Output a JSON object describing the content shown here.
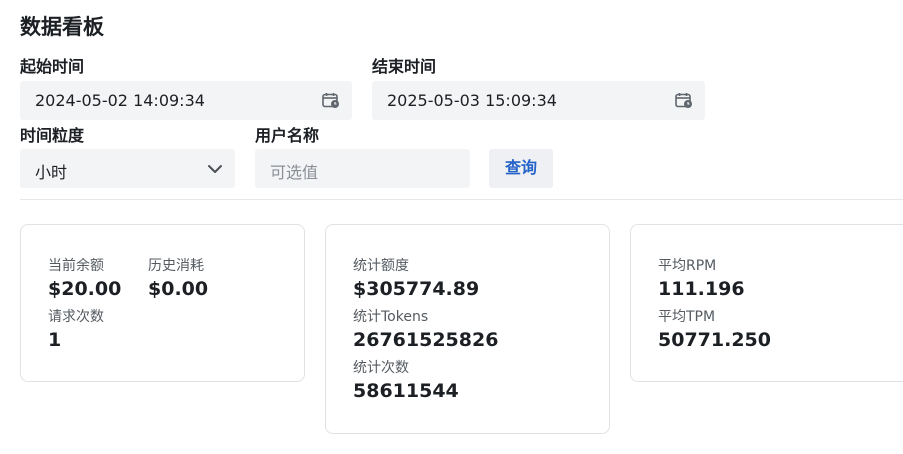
{
  "header": {
    "title": "数据看板"
  },
  "filters": {
    "start_time": {
      "label": "起始时间",
      "value": "2024-05-02 14:09:34",
      "icon": "calendar-clock-icon"
    },
    "end_time": {
      "label": "结束时间",
      "value": "2025-05-03 15:09:34",
      "icon": "calendar-clock-icon"
    },
    "granularity": {
      "label": "时间粒度",
      "value": "小时",
      "icon": "chevron-down-icon"
    },
    "username": {
      "label": "用户名称",
      "placeholder": "可选值",
      "value": ""
    },
    "query_label": "查询"
  },
  "cards": {
    "account": {
      "balance": {
        "label": "当前余额",
        "value": "$20.00"
      },
      "history_usage": {
        "label": "历史消耗",
        "value": "$0.00"
      },
      "request_count": {
        "label": "请求次数",
        "value": "1"
      }
    },
    "usage": {
      "quota": {
        "label": "统计额度",
        "value": "$305774.89"
      },
      "tokens": {
        "label": "统计Tokens",
        "value": "26761525826"
      },
      "count": {
        "label": "统计次数",
        "value": "58611544"
      }
    },
    "performance": {
      "rpm": {
        "label": "平均RPM",
        "value": "111.196"
      },
      "tpm": {
        "label": "平均TPM",
        "value": "50771.250"
      }
    }
  },
  "colors": {
    "accent": "#2463c9",
    "field_bg": "#f3f4f5",
    "border": "#e0e3e6"
  }
}
